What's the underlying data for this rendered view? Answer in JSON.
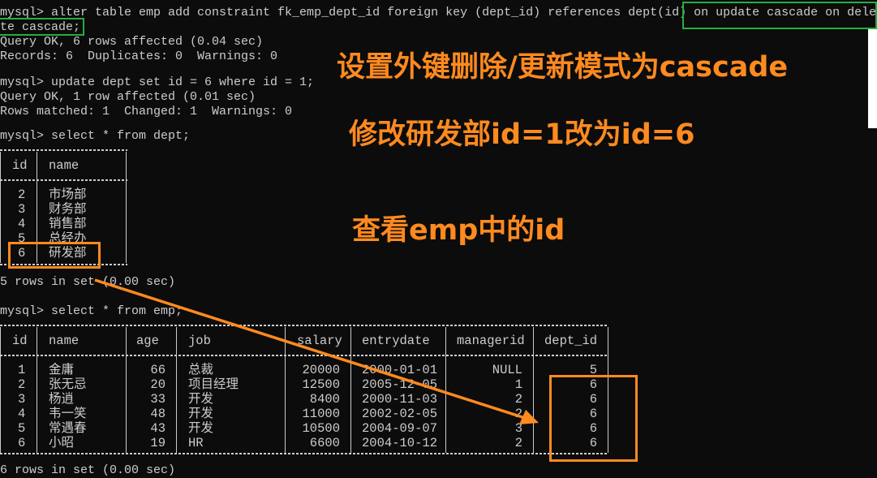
{
  "terminal": {
    "cmd1_line1": "mysql> alter table emp add constraint fk_emp_dept_id foreign key (dept_id) references dept(id) on update cascade on dele",
    "cmd1_line2": "te cascade;",
    "out1_line1": "Query OK, 6 rows affected (0.04 sec)",
    "out1_line2": "Records: 6  Duplicates: 0  Warnings: 0",
    "cmd2": "mysql> update dept set id = 6 where id = 1;",
    "out2_line1": "Query OK, 1 row affected (0.01 sec)",
    "out2_line2": "Rows matched: 1  Changed: 1  Warnings: 0",
    "cmd3": "mysql> select * from dept;",
    "dept_result": "5 rows in set (0.00 sec)",
    "cmd4": "mysql> select * from emp;",
    "emp_result": "6 rows in set (0.00 sec)"
  },
  "dept_table": {
    "columns": [
      "id",
      "name"
    ],
    "rows": [
      [
        "2",
        "市场部"
      ],
      [
        "3",
        "财务部"
      ],
      [
        "4",
        "销售部"
      ],
      [
        "5",
        "总经办"
      ],
      [
        "6",
        "研发部"
      ]
    ]
  },
  "emp_table": {
    "columns": [
      "id",
      "name",
      "age",
      "job",
      "salary",
      "entrydate",
      "managerid",
      "dept_id"
    ],
    "rows": [
      [
        "1",
        "金庸",
        "66",
        "总裁",
        "20000",
        "2000-01-01",
        "NULL",
        "5"
      ],
      [
        "2",
        "张无忌",
        "20",
        "项目经理",
        "12500",
        "2005-12-05",
        "1",
        "6"
      ],
      [
        "3",
        "杨逍",
        "33",
        "开发",
        "8400",
        "2000-11-03",
        "2",
        "6"
      ],
      [
        "4",
        "韦一笑",
        "48",
        "开发",
        "11000",
        "2002-02-05",
        "2",
        "6"
      ],
      [
        "5",
        "常遇春",
        "43",
        "开发",
        "10500",
        "2004-09-07",
        "3",
        "6"
      ],
      [
        "6",
        "小昭",
        "19",
        "HR",
        "6600",
        "2004-10-12",
        "2",
        "6"
      ]
    ]
  },
  "annotations": {
    "note1": "设置外键删除/更新模式为cascade",
    "note2": "修改研发部id=1改为id=6",
    "note3": "查看emp中的id"
  },
  "colors": {
    "background": "#0c0c0c",
    "text": "#cccccc",
    "highlight_green": "#21b03e",
    "highlight_orange": "#ff8a1f"
  }
}
